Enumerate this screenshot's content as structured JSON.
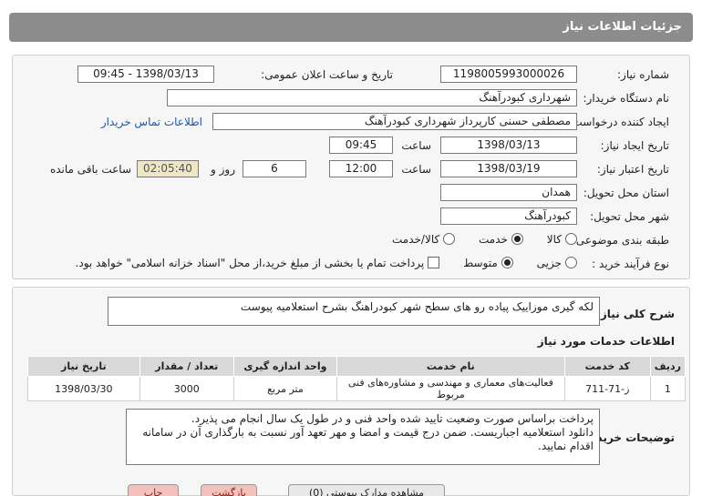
{
  "page": {
    "title": "جزئیات اطلاعات نیاز"
  },
  "info": {
    "need_number_label": "شماره نیاز:",
    "need_number": "1198005993000026",
    "announce_label": "تاریخ و ساعت اعلان عمومی:",
    "announce_value": "1398/03/13 - 09:45",
    "buyer_label": "نام دستگاه خریدار:",
    "buyer_value": "شهرداری کبودرآهنگ",
    "creator_label": "ایجاد کننده درخواست:",
    "creator_value": "مصطفی حسنی کارپرداز شهرداری کبودرآهنگ",
    "contact_link": "اطلاعات تماس خریدار",
    "created_label": "تاریخ ایجاد نیاز:",
    "created_date": "1398/03/13",
    "time_label": "ساعت",
    "created_time": "09:45",
    "valid_label": "تاریخ اعتبار نیاز:",
    "valid_date": "1398/03/19",
    "valid_time": "12:00",
    "days": "6",
    "days_label": "روز و",
    "remaining_time": "02:05:40",
    "remaining_label": "ساعت باقی مانده",
    "province_label": "استان محل تحویل:",
    "province_value": "همدان",
    "city_label": "شهر محل تحویل:",
    "city_value": "کبودرآهنگ",
    "category_label": "طبقه بندی موضوعی:",
    "category_options": [
      "کالا",
      "خدمت",
      "کالا/خدمت"
    ],
    "category_selected": "خدمت",
    "process_label": "نوع فرآیند خرید :",
    "process_options": [
      "جزیی",
      "متوسط"
    ],
    "process_selected": "متوسط",
    "payment_note": "پرداخت تمام یا بخشی از مبلغ خرید،از محل \"اسناد خزانه اسلامی\" خواهد بود."
  },
  "desc": {
    "summary_label": "شرح کلی نیاز:",
    "summary_value": "لکه گیری موزاییک پیاده رو های سطح شهر کبودراهنگ بشرح استعلامیه پیوست",
    "services_title": "اطلاعات خدمات مورد نیاز",
    "table": {
      "headers": [
        "ردیف",
        "کد خدمت",
        "نام خدمت",
        "واحد اندازه گیری",
        "تعداد / مقدار",
        "تاریخ نیاز"
      ],
      "rows": [
        [
          "1",
          "ز-71-711",
          "فعالیت‌های معماری و مهندسی و مشاوره‌های فنی مربوط",
          "متر مربع",
          "3000",
          "1398/03/30"
        ]
      ]
    },
    "buyer_notes_label": "توضیحات خریدار:",
    "buyer_notes": [
      "پرداخت براساس صورت وضعیت تایید شده واحد فنی و در طول یک سال انجام می پذیرد.",
      "دانلود استعلامیه اجباریست. ضمن درج قیمت و امضا و مهر تعهد آور نسبت به بارگذاری آن در سامانه",
      "اقدام نمایید."
    ]
  },
  "footer_buttons": [
    "مشاهده مدارک پیوستی (0)",
    "بازگشت",
    "چاپ"
  ],
  "colors": {
    "titlebar": "#8c8c8c",
    "link": "#1a57b5",
    "timer_bg": "#efe6c4",
    "table_header": "#d9d9d9"
  }
}
